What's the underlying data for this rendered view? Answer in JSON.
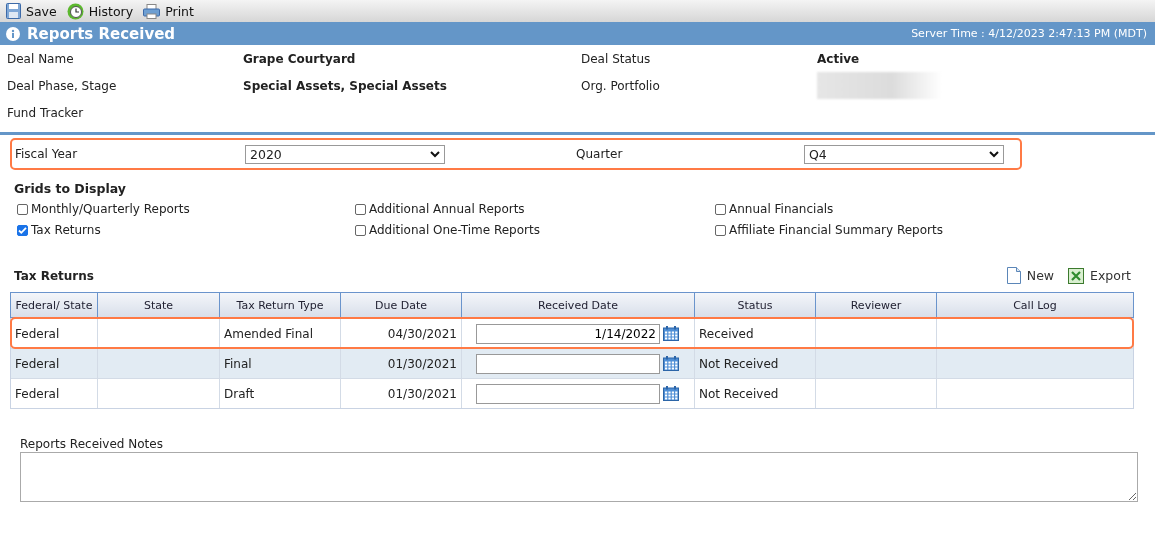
{
  "toolbar": [
    {
      "label": "Save",
      "kind": "save"
    },
    {
      "label": "History",
      "kind": "history"
    },
    {
      "label": "Print",
      "kind": "print"
    }
  ],
  "header": {
    "title": "Reports Received",
    "server_time": "Server Time : 4/12/2023 2:47:13 PM (MDT)"
  },
  "details": [
    {
      "label": "Deal Name",
      "value": "Grape Courtyard"
    },
    {
      "label": "Deal Status",
      "value": "Active"
    },
    {
      "label": "Deal Phase, Stage",
      "value": "Special Assets, Special Assets"
    },
    {
      "label": "Org. Portfolio",
      "redacted": true
    },
    {
      "label": "Fund Tracker"
    }
  ],
  "filters": {
    "highlighted": true,
    "items": [
      {
        "label": "Fiscal Year",
        "value": "2020"
      },
      {
        "label": "Quarter",
        "value": "Q4"
      }
    ]
  },
  "grids": {
    "title": "Grids to Display",
    "options": [
      {
        "label": "Monthly/Quarterly Reports",
        "checked": false
      },
      {
        "label": "Additional Annual Reports",
        "checked": false
      },
      {
        "label": "Annual Financials",
        "checked": false
      },
      {
        "label": "Tax Returns",
        "checked": true
      },
      {
        "label": "Additional One-Time Reports",
        "checked": false
      },
      {
        "label": "Affiliate Financial Summary Reports",
        "checked": false
      }
    ]
  },
  "tax_returns": {
    "title": "Tax Returns",
    "actions": [
      {
        "label": "New",
        "kind": "new"
      },
      {
        "label": "Export",
        "kind": "export"
      }
    ],
    "columns": [
      "Federal/ State",
      "State",
      "Tax Return Type",
      "Due Date",
      "Received Date",
      "Status",
      "Reviewer",
      "Call Log"
    ],
    "rows": [
      {
        "federal_state": "Federal",
        "type": "Amended Final",
        "due_date": "04/30/2021",
        "received_date": "1/14/2022",
        "status": "Received",
        "highlighted": true
      },
      {
        "federal_state": "Federal",
        "type": "Final",
        "due_date": "01/30/2021",
        "status": "Not Received",
        "highlighted": false
      },
      {
        "federal_state": "Federal",
        "type": "Draft",
        "due_date": "01/30/2021",
        "status": "Not Received",
        "highlighted": false
      }
    ]
  },
  "notes": {
    "label": "Reports Received Notes"
  }
}
